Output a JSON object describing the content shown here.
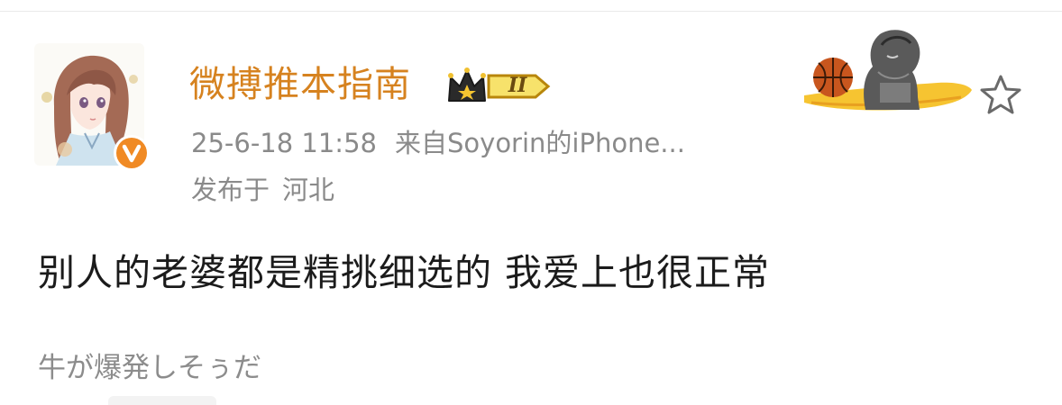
{
  "post": {
    "author": {
      "name": "微搏推本指南",
      "vip_level": "II",
      "avatar": "anime-girl-avatar",
      "verified_icon": "verified-v-icon",
      "verified_badge_color": "#f08a24"
    },
    "meta": {
      "time": "25-6-18 11:58",
      "source_label": "来自",
      "source": "Soyorin的iPhone...",
      "location_label": "发布于",
      "location": "河北"
    },
    "decoration_icon": "basketball-player-card-decoration",
    "favorite_icon": "star-outline-icon",
    "text": "别人的老婆都是精挑细选的 我爱上也很正常"
  },
  "comment": {
    "text": "牛が爆発しそぅだ"
  },
  "colors": {
    "username": "#d6821f",
    "meta": "#8a8a8a",
    "body": "#1b1b1b"
  }
}
